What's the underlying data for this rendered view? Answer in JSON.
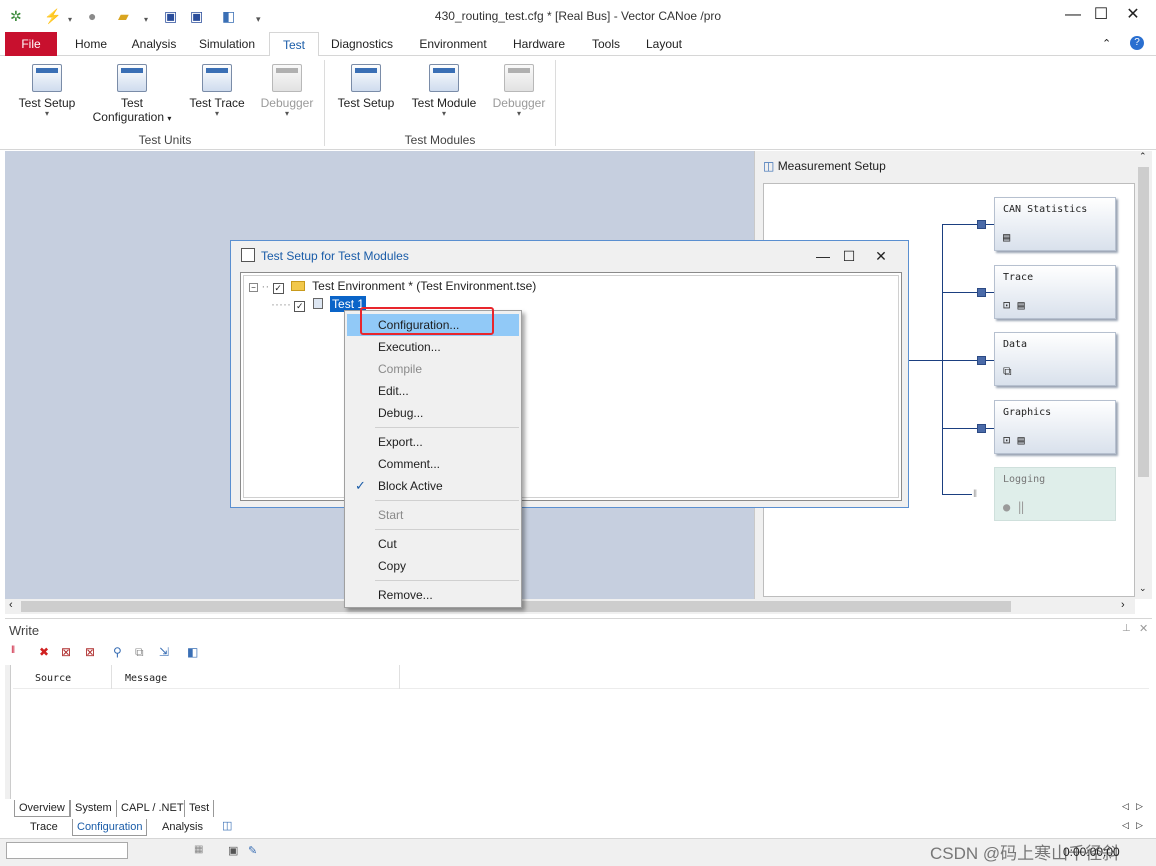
{
  "window": {
    "title": "430_routing_test.cfg * [Real Bus] - Vector CANoe /pro",
    "controls": [
      "—",
      "☐",
      "✕"
    ]
  },
  "ribbon_tabs": [
    "File",
    "Home",
    "Analysis",
    "Simulation",
    "Test",
    "Diagnostics",
    "Environment",
    "Hardware",
    "Tools",
    "Layout"
  ],
  "ribbon": {
    "test_units": {
      "label": "Test Units",
      "buttons": [
        {
          "line1": "Test Setup",
          "line2": ""
        },
        {
          "line1": "Test",
          "line2": "Configuration"
        },
        {
          "line1": "Test Trace",
          "line2": ""
        },
        {
          "line1": "Debugger",
          "line2": ""
        }
      ]
    },
    "test_modules": {
      "label": "Test Modules",
      "buttons": [
        {
          "line1": "Test Setup",
          "line2": ""
        },
        {
          "line1": "Test Module",
          "line2": ""
        },
        {
          "line1": "Debugger",
          "line2": ""
        }
      ]
    }
  },
  "measurement_setup": {
    "title": "Measurement Setup",
    "blocks": [
      "CAN Statistics",
      "Trace",
      "Data",
      "Graphics",
      "Logging"
    ]
  },
  "dialog": {
    "title": "Test Setup for Test Modules",
    "tree": {
      "root": "Test Environment *  (Test Environment.tse)",
      "child": "Test 1"
    }
  },
  "context_menu": {
    "items": [
      {
        "label": "Configuration...",
        "state": "highlighted"
      },
      {
        "label": "Execution...",
        "state": "normal"
      },
      {
        "label": "Compile",
        "state": "disabled"
      },
      {
        "label": "Edit...",
        "state": "normal"
      },
      {
        "label": "Debug...",
        "state": "normal"
      },
      {
        "label": "Export...",
        "state": "normal"
      },
      {
        "label": "Comment...",
        "state": "normal"
      },
      {
        "label": "Block Active",
        "state": "checked"
      },
      {
        "label": "Start",
        "state": "disabled"
      },
      {
        "label": "Cut",
        "state": "normal"
      },
      {
        "label": "Copy",
        "state": "normal"
      },
      {
        "label": "Remove...",
        "state": "normal"
      }
    ]
  },
  "write_window": {
    "title": "Write",
    "columns": [
      "Source",
      "Message"
    ],
    "tabs": [
      "Overview",
      "System",
      "CAPL / .NET",
      "Test"
    ]
  },
  "desktop_tabs": [
    "Trace",
    "Configuration",
    "Analysis"
  ],
  "status": {
    "time": "0:00:00:00",
    "watermark": "CSDN @码上寒山千径斜"
  },
  "colors": {
    "file_tab": "#c8102e",
    "accent": "#1a5ca8",
    "highlight_box": "#e8262c",
    "menu_hover": "#91c9f7",
    "workarea": "#c6cfdf"
  }
}
